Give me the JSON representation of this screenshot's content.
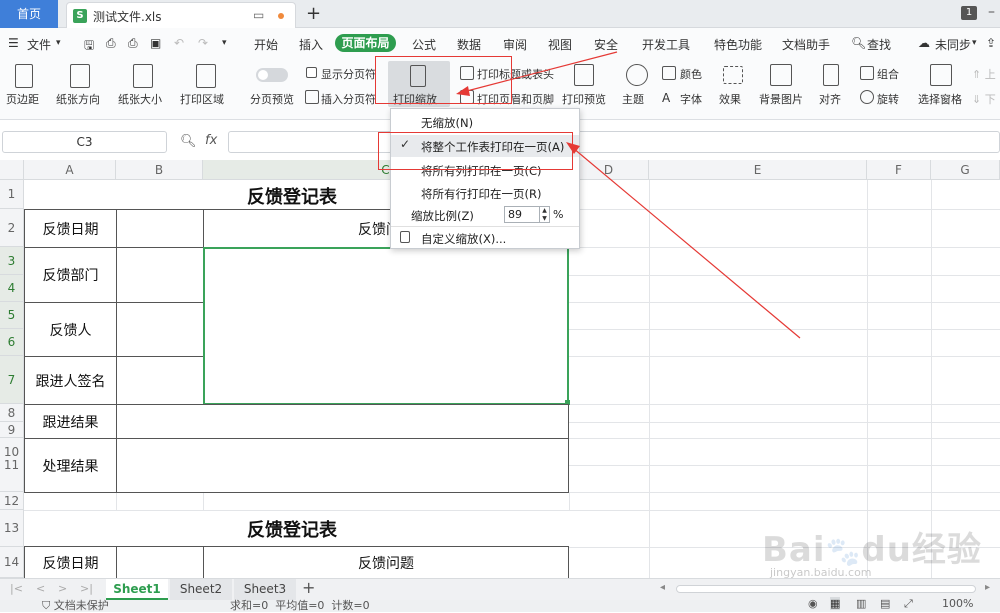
{
  "tabbar": {
    "home": "首页",
    "file_name": "测试文件.xls",
    "file_icon_letter": "S",
    "badge": "1"
  },
  "menubar": {
    "file": "文件",
    "items": [
      "开始",
      "插入",
      "页面布局",
      "公式",
      "数据",
      "审阅",
      "视图",
      "安全",
      "开发工具",
      "特色功能",
      "文档助手"
    ],
    "active": "页面布局",
    "search": "查找",
    "sync": "未同步"
  },
  "ribbon": {
    "margins": "页边距",
    "orientation": "纸张方向",
    "size": "纸张大小",
    "print_area": "打印区域",
    "page_break_preview": "分页预览",
    "show_page_break": "显示分页符",
    "insert_page_break": "插入分页符",
    "print_scale": "打印缩放",
    "print_titles": "打印标题或表头",
    "header_footer": "打印页眉和页脚",
    "print_preview": "打印预览",
    "theme": "主题",
    "colors": "颜色",
    "fonts": "字体",
    "effects": "效果",
    "background": "背景图片",
    "align": "对齐",
    "group": "组合",
    "rotate": "旋转",
    "selection_pane": "选择窗格",
    "up": "上",
    "down": "下"
  },
  "formula_bar": {
    "name_box": "C3",
    "fx": "fx"
  },
  "columns": [
    "A",
    "B",
    "C",
    "D",
    "E",
    "F",
    "G"
  ],
  "rows": [
    "1",
    "2",
    "3",
    "4",
    "5",
    "6",
    "7",
    "8",
    "9",
    "10",
    "11",
    "12",
    "13",
    "14"
  ],
  "table1": {
    "title": "反馈登记表",
    "date": "反馈日期",
    "issue": "反馈问题",
    "dept": "反馈部门",
    "person": "反馈人",
    "follower": "跟进人签名",
    "result": "跟进结果",
    "handle": "处理结果"
  },
  "table2": {
    "title": "反馈登记表",
    "date": "反馈日期",
    "issue": "反馈问题"
  },
  "dropdown": {
    "no_scale": "无缩放(N)",
    "fit_sheet": "将整个工作表打印在一页(A)",
    "fit_columns": "将所有列打印在一页(C)",
    "fit_rows": "将所有行打印在一页(R)",
    "scale_label": "缩放比例(Z)",
    "scale_value": "89",
    "percent": "%",
    "custom": "自定义缩放(X)..."
  },
  "sheets": [
    "Sheet1",
    "Sheet2",
    "Sheet3"
  ],
  "statusbar": {
    "protect": "文档未保护",
    "summary": "求和=0  平均值=0  计数=0",
    "zoom": "100%"
  },
  "watermark": {
    "logo": "Baidu经验",
    "url": "jingyan.baidu.com"
  },
  "colors": {
    "accent_green": "#2e9d4f",
    "annotation_red": "#e53935",
    "home_blue": "#3f7fd9",
    "selection_green": "#3aa35a"
  }
}
